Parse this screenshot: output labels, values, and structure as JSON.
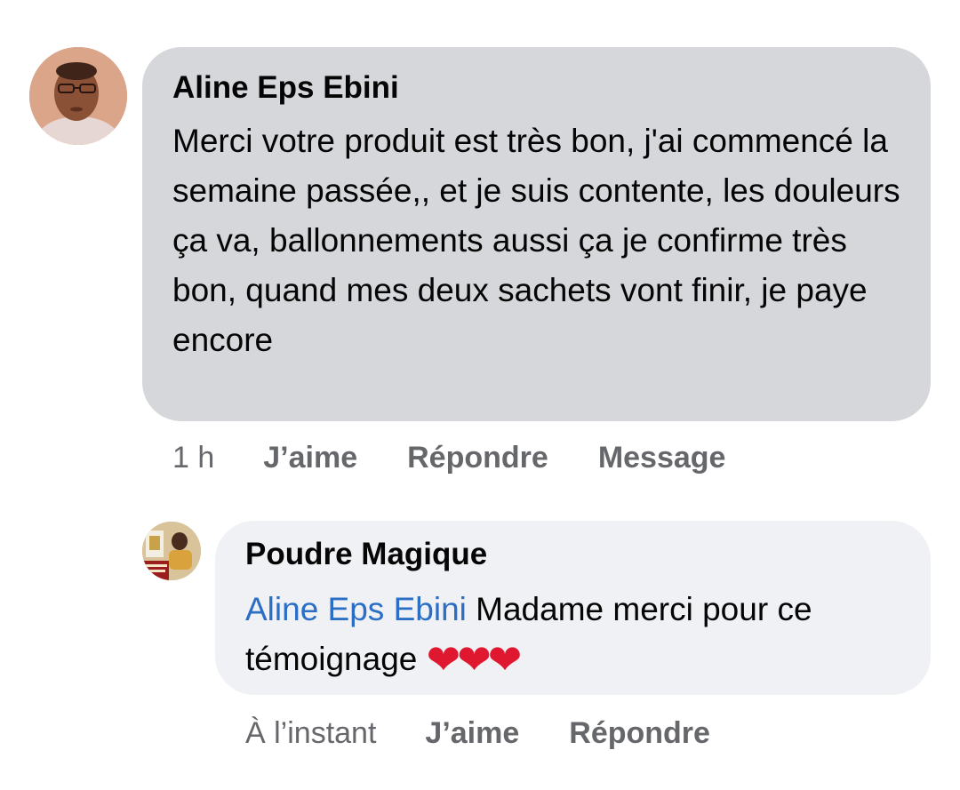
{
  "comments": [
    {
      "author": "Aline Eps Ebini",
      "text": "Merci votre produit est très bon, j'ai commencé la semaine passée,, et je suis contente, les douleurs ça va, ballonnements aussi ça je confirme très bon, quand mes deux sachets vont finir, je paye encore",
      "time": "1 h",
      "actions": {
        "like": "J’aime",
        "reply": "Répondre",
        "message": "Message"
      },
      "avatar_icon": "user-photo-avatar"
    },
    {
      "author": "Poudre Magique",
      "mention": "Aline Eps Ebini",
      "text": " Madame merci pour ce témoignage ",
      "emoji": "❤❤❤",
      "time": "À l’instant",
      "actions": {
        "like": "J’aime",
        "reply": "Répondre"
      },
      "avatar_icon": "page-logo-avatar"
    }
  ],
  "colors": {
    "bubble_primary": "#d6d7db",
    "bubble_reply": "#f0f1f4",
    "meta_text": "#65676b",
    "mention": "#2a6ec5",
    "heart": "#e0182f"
  }
}
